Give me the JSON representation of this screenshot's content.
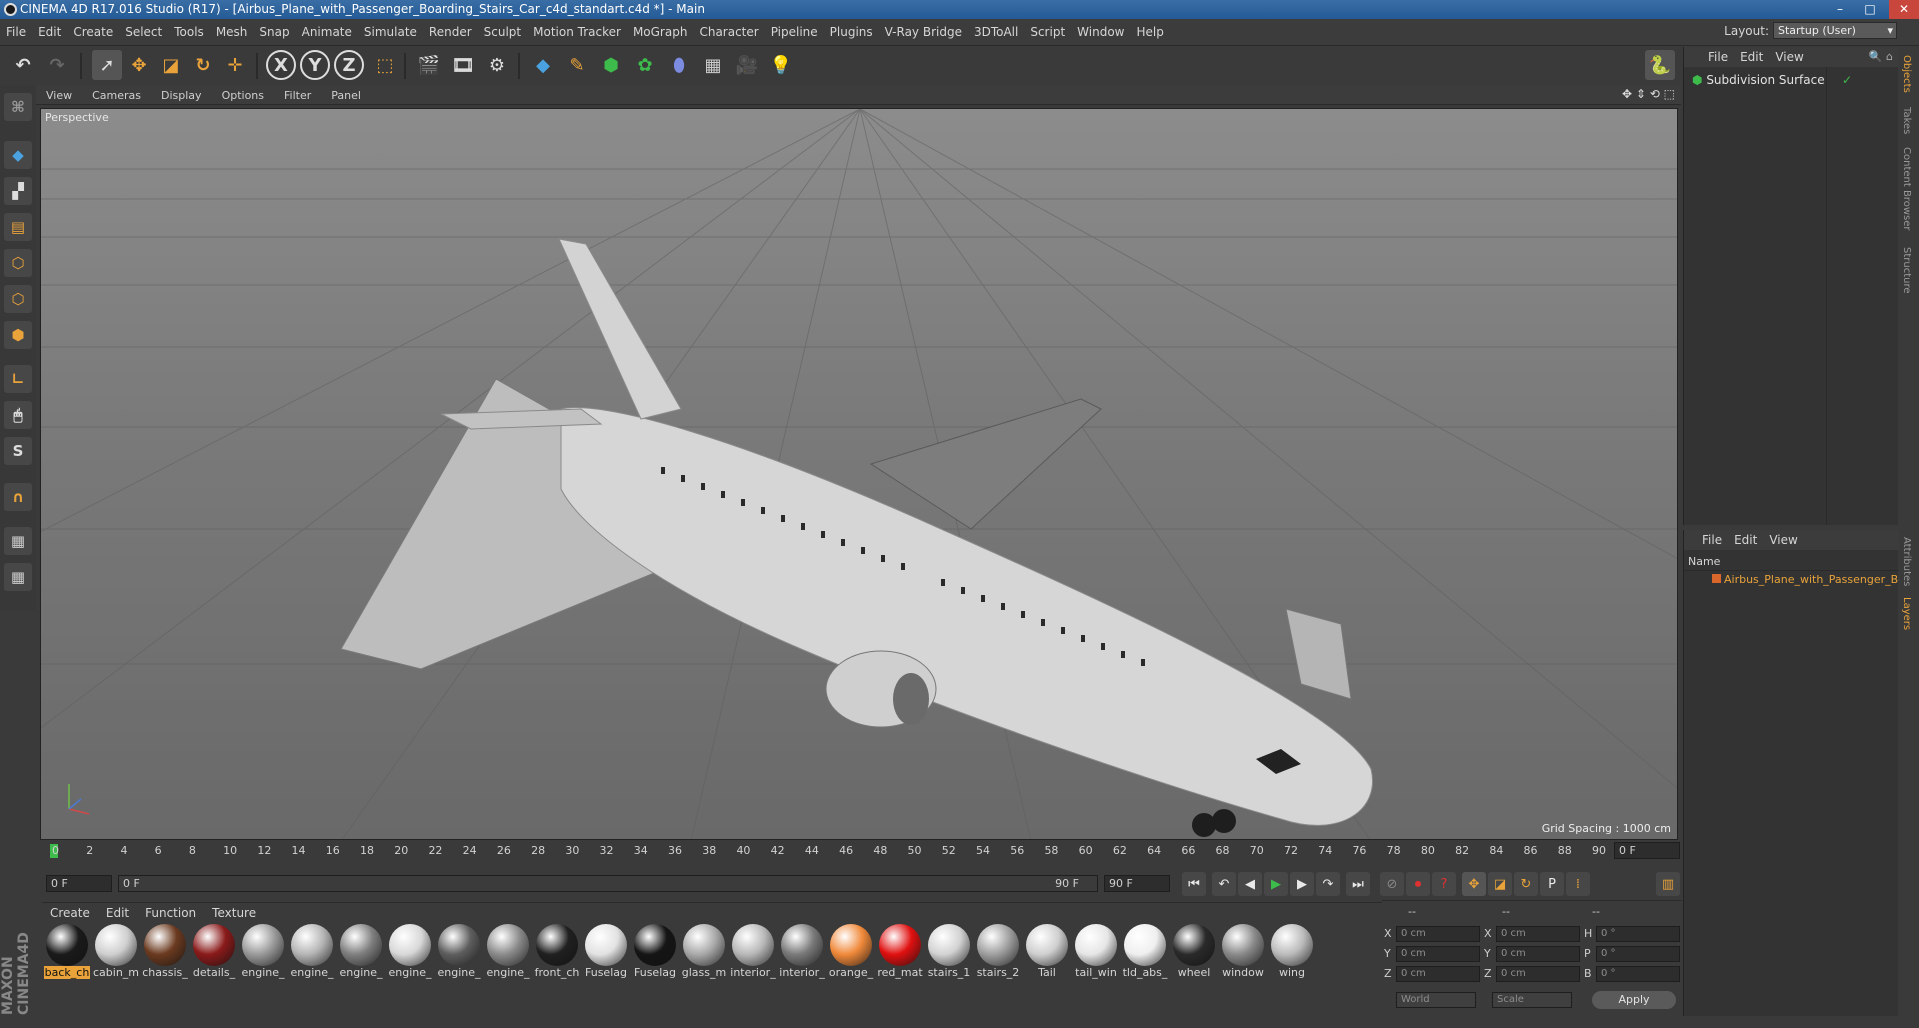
{
  "window": {
    "title": "CINEMA 4D R17.016 Studio (R17) - [Airbus_Plane_with_Passenger_Boarding_Stairs_Car_c4d_standart.c4d *] - Main",
    "minimize": "–",
    "maximize": "□",
    "close": "✕"
  },
  "menu": [
    "File",
    "Edit",
    "Create",
    "Select",
    "Tools",
    "Mesh",
    "Snap",
    "Animate",
    "Simulate",
    "Render",
    "Sculpt",
    "Motion Tracker",
    "MoGraph",
    "Character",
    "Pipeline",
    "Plugins",
    "V-Ray Bridge",
    "3DToAll",
    "Script",
    "Window",
    "Help"
  ],
  "layout": {
    "label": "Layout:",
    "value": "Startup (User)"
  },
  "viewport": {
    "menu": [
      "View",
      "Cameras",
      "Display",
      "Options",
      "Filter",
      "Panel"
    ],
    "camera_label": "Perspective",
    "grid_spacing": "Grid Spacing : 1000 cm"
  },
  "timeline": {
    "ticks": [
      "0",
      "2",
      "4",
      "6",
      "8",
      "10",
      "12",
      "14",
      "16",
      "18",
      "20",
      "22",
      "24",
      "26",
      "28",
      "30",
      "32",
      "34",
      "36",
      "38",
      "40",
      "42",
      "44",
      "46",
      "48",
      "50",
      "52",
      "54",
      "56",
      "58",
      "60",
      "62",
      "64",
      "66",
      "68",
      "70",
      "72",
      "74",
      "76",
      "78",
      "80",
      "82",
      "84",
      "86",
      "88",
      "90"
    ],
    "current_frame": "0 F",
    "start_field": "0 F",
    "range_start": "0 F",
    "range_end": "90 F",
    "end_field": "90 F"
  },
  "materials_menu": [
    "Create",
    "Edit",
    "Function",
    "Texture"
  ],
  "materials": [
    {
      "name": "back_ch",
      "color": "#1a1a1a"
    },
    {
      "name": "cabin_m",
      "color": "#cfcfcf"
    },
    {
      "name": "chassis_",
      "color": "#6b3a1f"
    },
    {
      "name": "details_",
      "color": "#8a1a1a"
    },
    {
      "name": "engine_",
      "color": "#9a9a9a"
    },
    {
      "name": "engine_",
      "color": "#b5b5b5"
    },
    {
      "name": "engine_",
      "color": "#7f7f7f"
    },
    {
      "name": "engine_",
      "color": "#d8d8d8"
    },
    {
      "name": "engine_",
      "color": "#5e5e5e"
    },
    {
      "name": "engine_",
      "color": "#8b8b8b"
    },
    {
      "name": "front_ch",
      "color": "#202020"
    },
    {
      "name": "Fuselag",
      "color": "#e2e2e2"
    },
    {
      "name": "Fuselag",
      "color": "#151515"
    },
    {
      "name": "glass_m",
      "color": "#a9a9a9"
    },
    {
      "name": "interior_",
      "color": "#b8b8b8"
    },
    {
      "name": "interior_",
      "color": "#7a7a7a"
    },
    {
      "name": "orange_",
      "color": "#f0893a"
    },
    {
      "name": "red_mat",
      "color": "#e01010"
    },
    {
      "name": "stairs_1",
      "color": "#d2d2d2"
    },
    {
      "name": "stairs_2",
      "color": "#9f9f9f"
    },
    {
      "name": "Tail",
      "color": "#cfcfcf"
    },
    {
      "name": "tail_win",
      "color": "#e6e6e6"
    },
    {
      "name": "tld_abs_",
      "color": "#efefef"
    },
    {
      "name": "wheel",
      "color": "#2a2a2a"
    },
    {
      "name": "window",
      "color": "#8a8a8a"
    },
    {
      "name": "wing",
      "color": "#bbbbbb"
    }
  ],
  "coords": {
    "headers": [
      "--",
      "--",
      "--"
    ],
    "rows": [
      {
        "a": "X",
        "av": "0 cm",
        "b": "X",
        "bv": "0 cm",
        "c": "H",
        "cv": "0 °"
      },
      {
        "a": "Y",
        "av": "0 cm",
        "b": "Y",
        "bv": "0 cm",
        "c": "P",
        "cv": "0 °"
      },
      {
        "a": "Z",
        "av": "0 cm",
        "b": "Z",
        "bv": "0 cm",
        "c": "B",
        "cv": "0 °"
      }
    ],
    "world": "World",
    "scale": "Scale",
    "apply": "Apply"
  },
  "objects": {
    "menu": [
      "File",
      "Edit",
      "View"
    ],
    "item": "Subdivision Surface"
  },
  "layers": {
    "menu": [
      "File",
      "Edit",
      "View"
    ],
    "column": "Name",
    "item": "Airbus_Plane_with_Passenger_Boa"
  },
  "side_tabs": [
    "Objects",
    "Takes",
    "Content Browser",
    "Structure",
    "Attributes",
    "Layers"
  ],
  "brand": "MAXON CINEMA4D",
  "colors": {
    "accent": "#e9a33a",
    "selection_blue": "#3e85c6"
  }
}
